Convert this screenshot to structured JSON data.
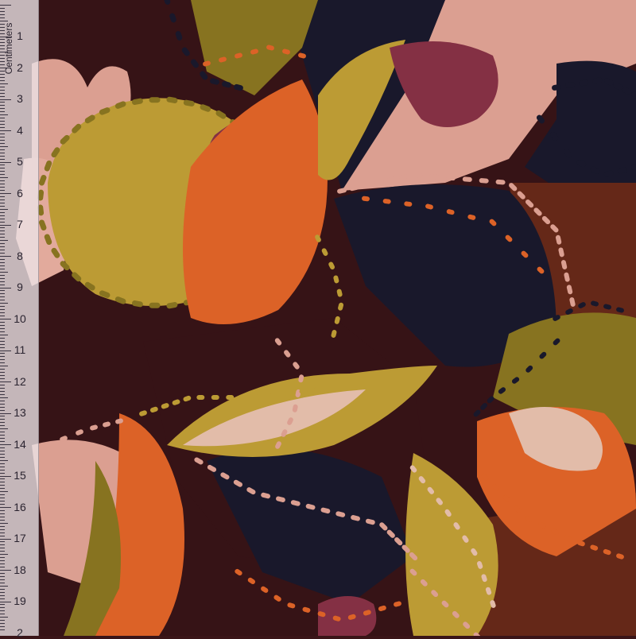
{
  "image": {
    "subject": "printed-fabric-swatch",
    "palette": {
      "background": "#3a1518",
      "navy": "#1b1a2e",
      "plum": "#5a1e2a",
      "chocolate": "#6b2b1a",
      "olive": "#8f7a22",
      "mustard": "#c7a438",
      "orange": "#e9682a",
      "pink": "#e8a99a",
      "blush": "#f0c7b3",
      "berry": "#8c3348"
    }
  },
  "ruler": {
    "unit_label": "Centimeters",
    "labels": [
      "1",
      "2",
      "3",
      "4",
      "5",
      "6",
      "7",
      "8",
      "9",
      "10",
      "11",
      "12",
      "13",
      "14",
      "15",
      "16",
      "17",
      "18",
      "19",
      "2"
    ]
  }
}
